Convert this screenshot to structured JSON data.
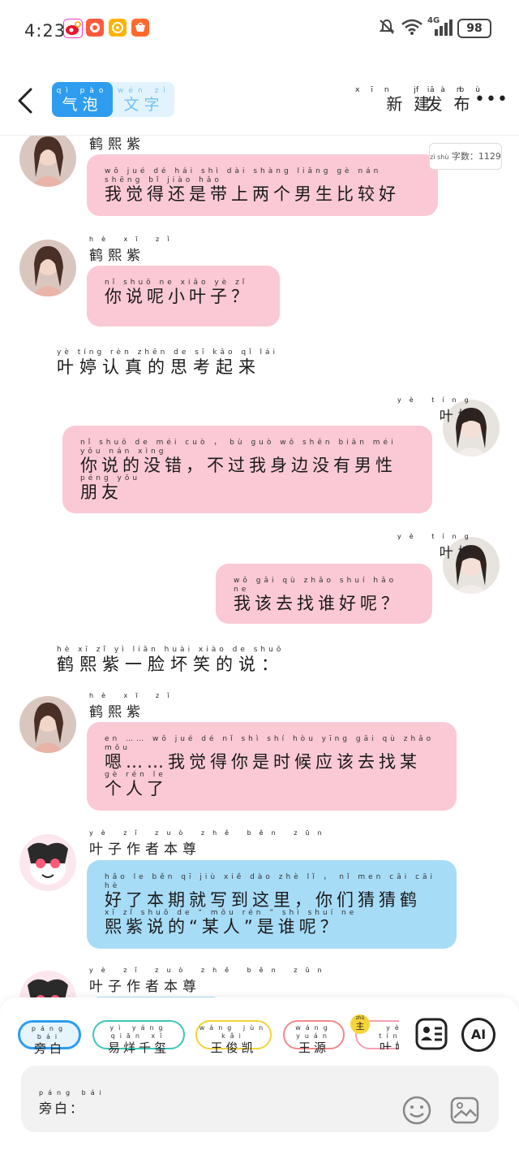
{
  "status_bar": {
    "time": "4:23",
    "network": "4G",
    "battery": "98"
  },
  "header": {
    "mode_bubble": {
      "py": "qì pào",
      "label": "气泡"
    },
    "mode_text": {
      "py": "wén zì",
      "label": "文字"
    },
    "new_button": {
      "py": "xīn jiàn",
      "label": "新建"
    },
    "publish_button": {
      "py": "fā bù",
      "label": "发布"
    },
    "more": "•••"
  },
  "word_count": {
    "py": "zì shù",
    "label": "字数：1129"
  },
  "messages": [
    {
      "name_py": "",
      "name": "鹤熙紫",
      "py": "wǒ jué dé hái shì dài shàng liǎng gè nán shēng bǐ jiào hǎo",
      "text": "我觉得还是带上两个男生比较好"
    },
    {
      "name_py": "hè xī zǐ",
      "name": "鹤熙紫",
      "py": "nǐ shuō ne xiǎo yè zǐ",
      "text": "你说呢小叶子？"
    },
    {
      "py": "yè tíng rèn zhēn de sī kǎo qǐ lái",
      "text": "叶婷认真的思考起来"
    },
    {
      "name_py": "yè tíng",
      "name": "叶婷",
      "py": "nǐ shuō de méi cuò ， bù guò wǒ shēn biān méi yǒu nán xìng",
      "text": "你说的没错，不过我身边没有男性",
      "py2": "péng yǒu",
      "text2": "朋友"
    },
    {
      "name_py": "yè tíng",
      "name": "叶婷",
      "py": "wǒ gāi qù zhǎo shuí hǎo ne",
      "text": "我该去找谁好呢？"
    },
    {
      "py": "hè xī zǐ yì liǎn huài xiào de shuō",
      "text": "鹤熙紫一脸坏笑的说："
    },
    {
      "name_py": "hè xī zǐ",
      "name": "鹤熙紫",
      "py": "en …… wǒ jué dé nǐ shì shí hòu yīng gāi qù zhǎo mǒu",
      "text": "嗯……我觉得你是时候应该去找某",
      "py2": "gè rén le",
      "text2": "个人了"
    },
    {
      "name_py": "yè zǐ zuò zhě běn zūn",
      "name": "叶子作者本尊",
      "py": "hǎo le běn qī jiù xiě dào zhè lǐ ， nǐ men cāi cāi hè",
      "text": "好了本期就写到这里，你们猜猜鹤",
      "py2": "xī zǐ shuō de “ mǒu rén ” shì shuí ne",
      "text2": "熙紫说的“某人”是谁呢？"
    },
    {
      "name_py": "yè zǐ zuò zhě běn zūn",
      "name": "叶子作者本尊"
    }
  ],
  "roles": [
    {
      "py": "páng bái",
      "label": "旁白"
    },
    {
      "py": "yì yáng qiān xǐ",
      "label": "易烊千玺"
    },
    {
      "py": "wáng jùn kǎi",
      "label": "王俊凯"
    },
    {
      "py": "wáng yuán",
      "label": "王源"
    },
    {
      "py": "yè tíng",
      "label": "叶婷",
      "badge_py": "zhǔ",
      "badge": "主"
    }
  ],
  "input": {
    "py": "páng bái",
    "label": "旁白："
  },
  "ai_label": "AI",
  "colors": {
    "accent": "#2e9df0",
    "pink_bubble": "#fbc9d6",
    "blue_bubble": "#a7dcf7"
  }
}
